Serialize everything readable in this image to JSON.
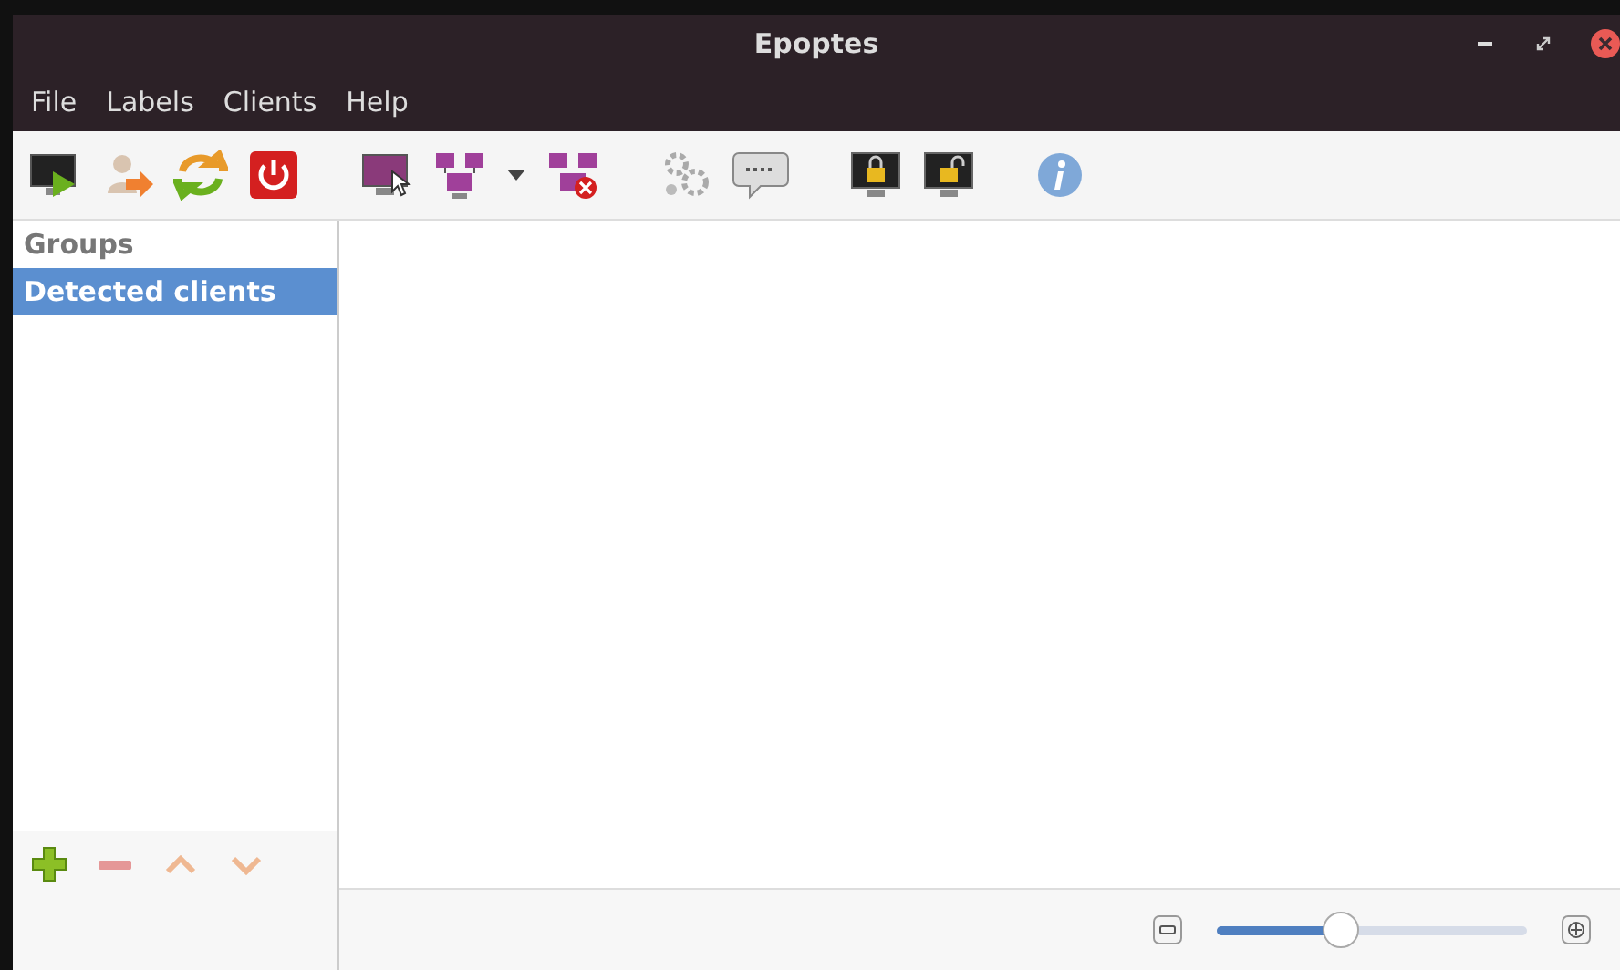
{
  "window": {
    "title": "Epoptes"
  },
  "menu": [
    "File",
    "Labels",
    "Clients",
    "Help"
  ],
  "sidebar": {
    "header": "Groups",
    "items": [
      {
        "label": "Detected clients",
        "selected": true
      }
    ],
    "buttons": [
      {
        "kind": "add",
        "disabled": false
      },
      {
        "kind": "remove",
        "disabled": true
      },
      {
        "kind": "up",
        "disabled": true
      },
      {
        "kind": "down",
        "disabled": true
      }
    ]
  },
  "zoom": {
    "level": 0.38
  }
}
